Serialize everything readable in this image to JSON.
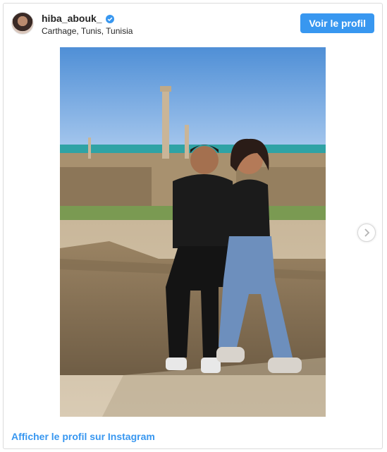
{
  "header": {
    "username": "hiba_abouk_",
    "location": "Carthage, Tunis, Tunisia",
    "view_profile_label": "Voir le profil"
  },
  "footer": {
    "link_label": "Afficher le profil sur Instagram"
  },
  "icons": {
    "verified": "verified-badge-icon",
    "next": "chevron-right-icon"
  },
  "colors": {
    "accent": "#3897f0",
    "text": "#262626",
    "border": "#dbdbdb"
  }
}
